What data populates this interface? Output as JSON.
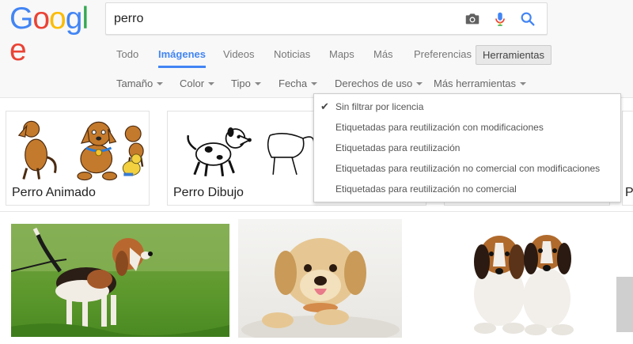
{
  "logo": {
    "letters": [
      "G",
      "o",
      "o",
      "g",
      "l",
      "e"
    ],
    "colors": [
      "#4285f4",
      "#ea4335",
      "#fbbc05",
      "#4285f4",
      "#34a853",
      "#ea4335"
    ]
  },
  "search": {
    "query": "perro"
  },
  "tabs": [
    "Todo",
    "Imágenes",
    "Videos",
    "Noticias",
    "Maps",
    "Más",
    "Preferencias"
  ],
  "active_tab": "Imágenes",
  "tools_label": "Herramientas",
  "filters": [
    "Tamaño",
    "Color",
    "Tipo",
    "Fecha",
    "Derechos de uso",
    "Más herramientas"
  ],
  "categories": [
    "Perro Animado",
    "Perro Dibujo",
    "P"
  ],
  "dropdown": {
    "items": [
      "Sin filtrar por licencia",
      "Etiquetadas para reutilización con modificaciones",
      "Etiquetadas para reutilización",
      "Etiquetadas para reutilización no comercial con modificaciones",
      "Etiquetadas para reutilización no comercial"
    ],
    "checked_index": 0
  },
  "icons": {
    "camera": "camera-icon",
    "mic": "microphone-icon",
    "search": "search-icon",
    "check": "checkmark-icon"
  },
  "colors": {
    "accent": "#4285f4",
    "mic_red": "#ea4335"
  }
}
